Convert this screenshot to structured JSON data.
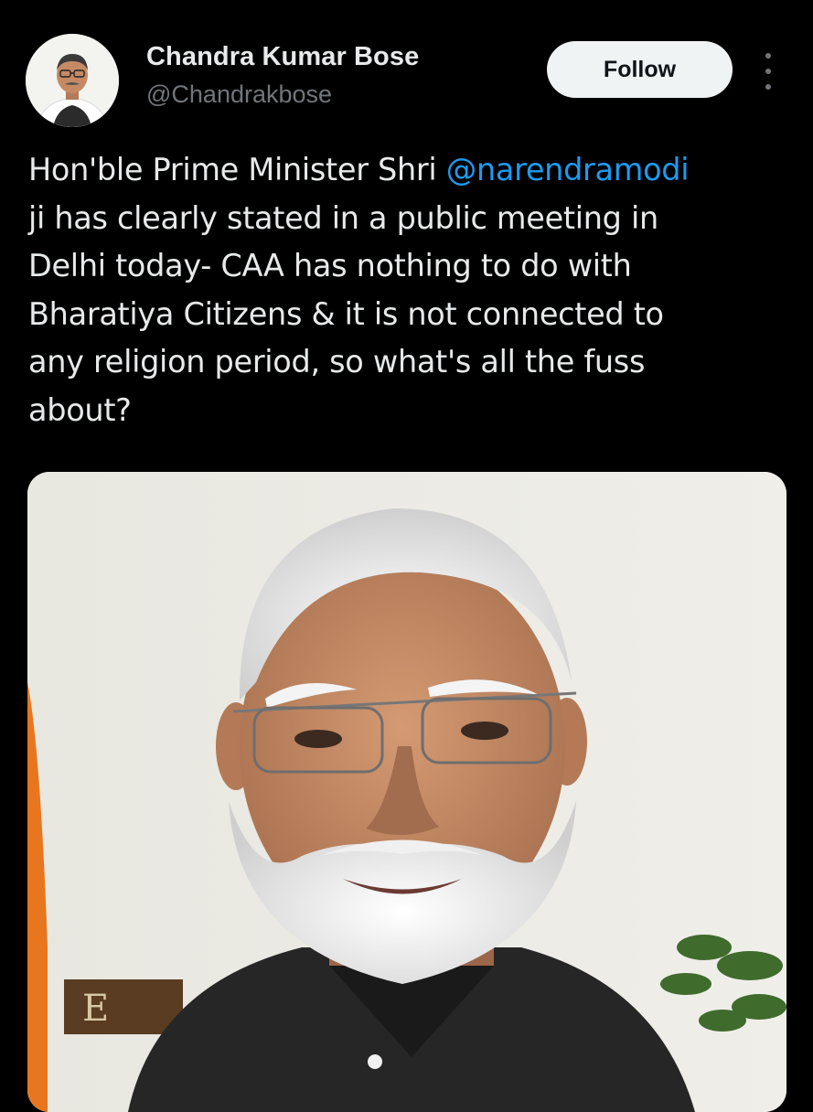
{
  "author": {
    "display_name": "Chandra Kumar Bose",
    "handle": "@Chandrakbose"
  },
  "actions": {
    "follow_label": "Follow",
    "more_icon": "more-vertical-icon"
  },
  "tweet": {
    "text_before_mention": "Hon'ble Prime Minister Shri ",
    "mention": "@narendramodi",
    "text_after_mention": "\nji has clearly stated in a public meeting in\nDelhi today- CAA has nothing to do with\nBharatiya Citizens & it is not connected to\nany religion period, so what's all the fuss\nabout?"
  },
  "colors": {
    "background": "#000000",
    "text": "#e7e9ea",
    "secondary_text": "#71767b",
    "mention": "#1d9bf0",
    "follow_bg": "#eff3f4"
  }
}
